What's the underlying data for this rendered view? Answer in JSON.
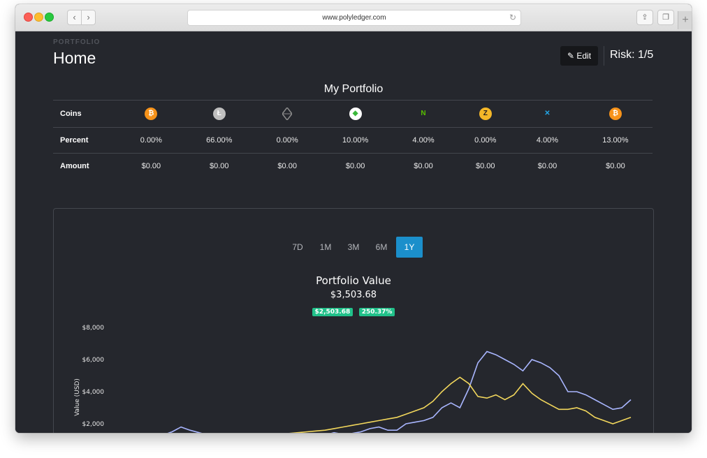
{
  "browser": {
    "url": "www.polyledger.com"
  },
  "header": {
    "kicker": "PORTFOLIO",
    "title": "Home",
    "edit_label": "Edit",
    "risk_label": "Risk: 1/5"
  },
  "portfolio": {
    "title": "My Portfolio",
    "row_labels": {
      "coins": "Coins",
      "percent": "Percent",
      "amount": "Amount"
    },
    "coins": [
      {
        "icon": "bitcoin-icon",
        "glyph": "₿",
        "bg": "#f7931a",
        "fg": "#ffffff",
        "percent": "0.00%",
        "amount": "$0.00"
      },
      {
        "icon": "litecoin-icon",
        "glyph": "Ł",
        "bg": "#bfbfbf",
        "fg": "#ffffff",
        "percent": "66.00%",
        "amount": "$0.00"
      },
      {
        "icon": "ethereum-icon",
        "glyph": "",
        "bg": "transparent",
        "fg": "#8a8a8a",
        "percent": "0.00%",
        "amount": "$0.00"
      },
      {
        "icon": "ethereum-classic-icon",
        "glyph": "◆",
        "bg": "#ffffff",
        "fg": "#3ab83a",
        "percent": "10.00%",
        "amount": "$0.00"
      },
      {
        "icon": "neo-icon",
        "glyph": "N",
        "bg": "transparent",
        "fg": "#58bf00",
        "percent": "4.00%",
        "amount": "$0.00"
      },
      {
        "icon": "zcash-icon",
        "glyph": "Z",
        "bg": "#f4b728",
        "fg": "#231f20",
        "percent": "0.00%",
        "amount": "$0.00"
      },
      {
        "icon": "ripple-icon",
        "glyph": "✕",
        "bg": "transparent",
        "fg": "#23a6e6",
        "percent": "4.00%",
        "amount": "$0.00"
      },
      {
        "icon": "bitcoin-cash-icon",
        "glyph": "₿",
        "bg": "#f7931a",
        "fg": "#ffffff",
        "percent": "13.00%",
        "amount": "$0.00"
      }
    ]
  },
  "chart": {
    "ranges": [
      {
        "label": "7D",
        "active": false
      },
      {
        "label": "1M",
        "active": false
      },
      {
        "label": "3M",
        "active": false
      },
      {
        "label": "6M",
        "active": false
      },
      {
        "label": "1Y",
        "active": true
      }
    ],
    "title": "Portfolio Value",
    "value": "$3,503.68",
    "change_amount": "$2,503.68",
    "change_percent": "250.37%"
  },
  "chart_data": {
    "type": "line",
    "title": "Portfolio Value",
    "ylabel": "Value (USD)",
    "xlabel": "",
    "ylim": [
      1000,
      8000
    ],
    "yticks": [
      2000,
      4000,
      6000,
      8000
    ],
    "ytick_labels": [
      "$2,000",
      "$4,000",
      "$6,000",
      "$8,000"
    ],
    "grid": false,
    "series": [
      {
        "color": "#a9b6ff",
        "values": [
          1000,
          1050,
          1000,
          1100,
          1200,
          1300,
          1500,
          1800,
          1600,
          1450,
          1300,
          1200,
          1100,
          1000,
          1100,
          1050,
          1000,
          1100,
          1200,
          1300,
          1400,
          1350,
          1300,
          1300,
          1450,
          1350,
          1400,
          1500,
          1700,
          1800,
          1600,
          1600,
          2000,
          2100,
          2200,
          2400,
          3000,
          3300,
          3000,
          4200,
          5800,
          6500,
          6300,
          6000,
          5700,
          5300,
          6000,
          5800,
          5500,
          5000,
          4000,
          4000,
          3800,
          3500,
          3200,
          2900,
          3000,
          3500
        ]
      },
      {
        "color": "#f2d75c",
        "values": [
          1000,
          1100,
          1100,
          1150,
          1200,
          1250,
          1350,
          1400,
          1300,
          1250,
          1200,
          1150,
          1100,
          1100,
          1100,
          1150,
          1200,
          1250,
          1300,
          1400,
          1450,
          1500,
          1550,
          1600,
          1700,
          1800,
          1900,
          2000,
          2100,
          2200,
          2300,
          2400,
          2600,
          2800,
          3000,
          3400,
          4000,
          4500,
          4900,
          4500,
          3700,
          3600,
          3800,
          3500,
          3800,
          4500,
          3900,
          3500,
          3200,
          2900,
          2900,
          3000,
          2800,
          2400,
          2200,
          2000,
          2200,
          2400
        ]
      }
    ]
  }
}
